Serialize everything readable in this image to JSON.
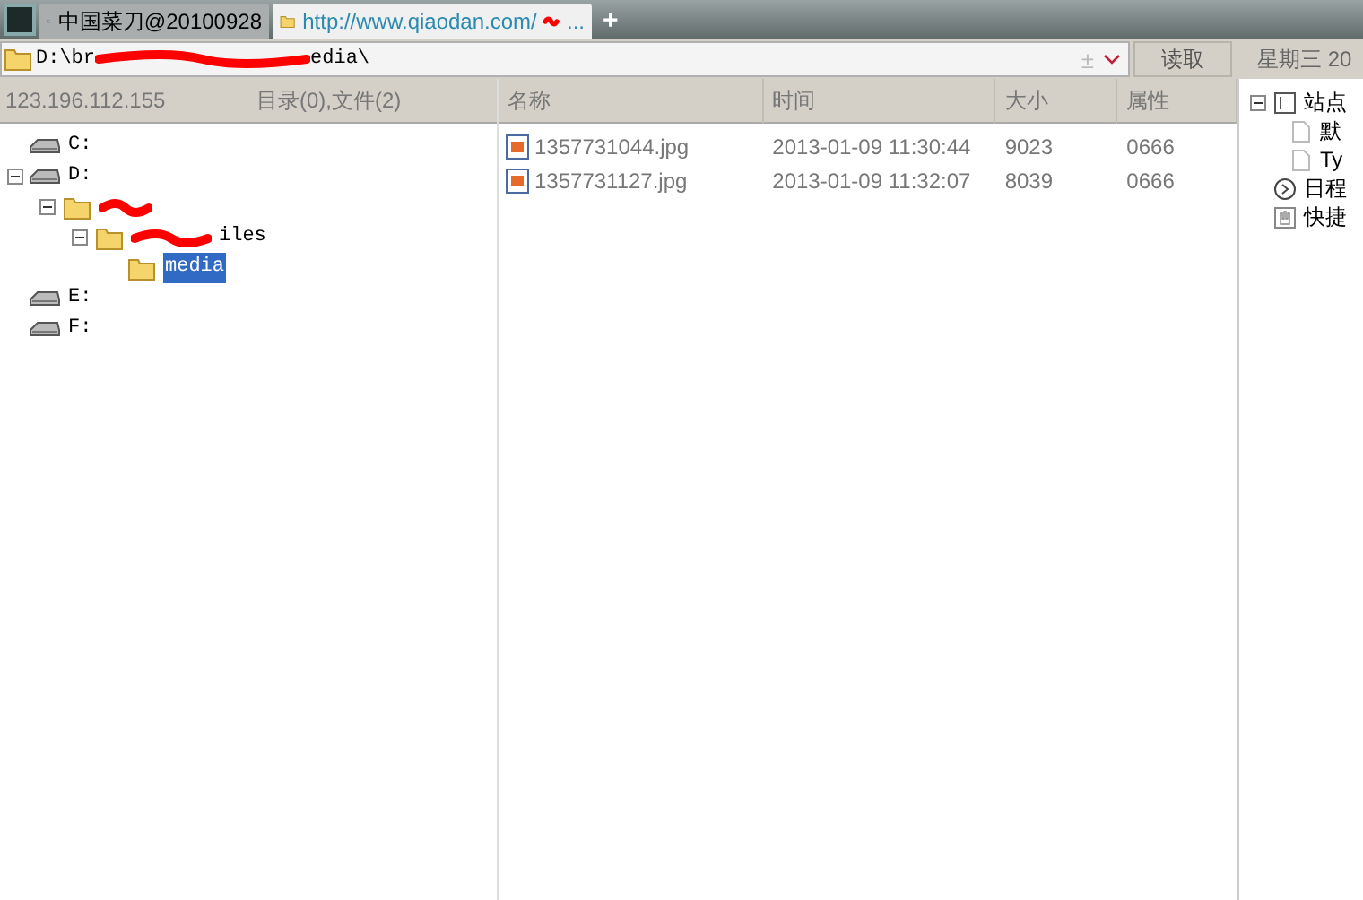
{
  "tabs": [
    {
      "label": "中国菜刀@20100928",
      "selected": false
    },
    {
      "label": "http://www.qiaodan.com/",
      "after": "...",
      "selected": true
    }
  ],
  "new_tab": "+",
  "address": {
    "before": "D:\\br",
    "after": "edia\\"
  },
  "field_icon": "±",
  "read_button": "读取",
  "date": "星期三 20",
  "status": {
    "ip": "123.196.112.155",
    "counts": "目录(0),文件(2)"
  },
  "tree": [
    {
      "kind": "drive",
      "label": "C:",
      "selected": false
    },
    {
      "kind": "drive",
      "label": "D:",
      "expanded": true,
      "selected": false,
      "children": [
        {
          "kind": "folder",
          "redacted": true,
          "expanded": true,
          "selected": false,
          "children": [
            {
              "kind": "folder",
              "label": "iles",
              "redacted": true,
              "expanded": true,
              "selected": false,
              "children": [
                {
                  "kind": "folder",
                  "label": "media",
                  "selected": true
                }
              ]
            }
          ]
        }
      ]
    },
    {
      "kind": "drive",
      "label": "E:",
      "selected": false
    },
    {
      "kind": "drive",
      "label": "F:",
      "selected": false
    }
  ],
  "table": {
    "columns": [
      "名称",
      "时间",
      "大小",
      "属性"
    ],
    "rows": [
      [
        "1357731044.jpg",
        "2013-01-09 11:30:44",
        "9023",
        "0666"
      ],
      [
        "1357731127.jpg",
        "2013-01-09 11:32:07",
        "8039",
        "0666"
      ]
    ]
  },
  "side_tree": [
    {
      "kind": "site",
      "label": "站点",
      "expanded": true,
      "children": [
        {
          "kind": "page",
          "label": "默"
        },
        {
          "kind": "page",
          "label": "Ty"
        }
      ]
    },
    {
      "kind": "schedule",
      "label": "日程"
    },
    {
      "kind": "shortcut",
      "label": "快捷"
    }
  ]
}
